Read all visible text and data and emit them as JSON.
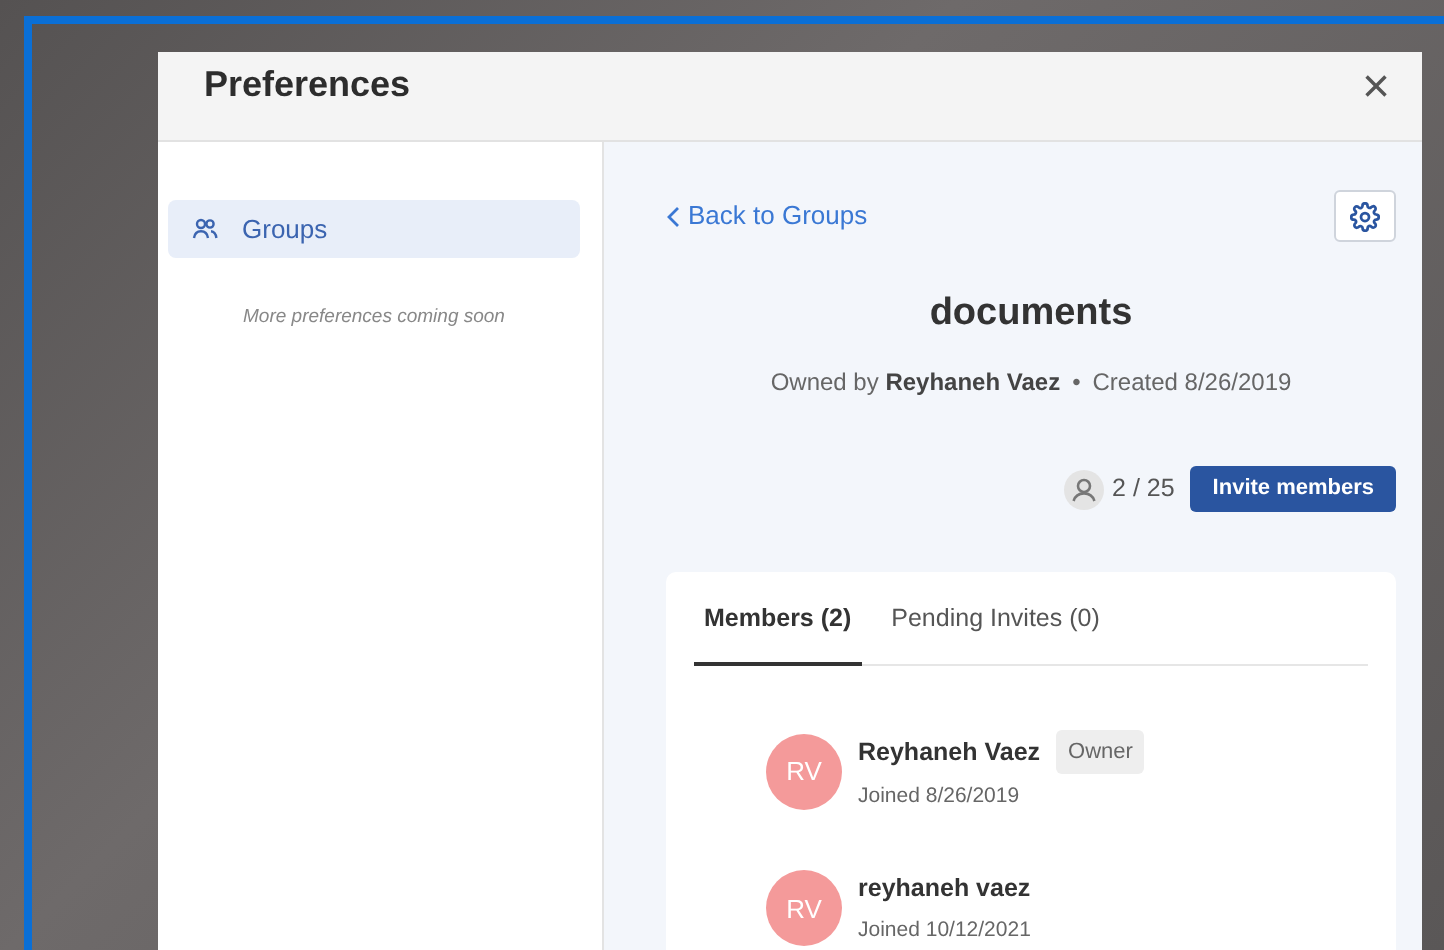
{
  "dialog": {
    "title": "Preferences",
    "close": "×"
  },
  "sidebar": {
    "items": [
      {
        "label": "Groups",
        "selected": true
      }
    ],
    "note": "More preferences coming soon"
  },
  "group": {
    "back_link": "Back to Groups",
    "name": "documents",
    "owner_prefix": "Owned by",
    "owner": "Reyhaneh Vaez",
    "separator": "•",
    "created": "Created 8/26/2019",
    "member_count": "2 / 25",
    "invite_button": "Invite members"
  },
  "tabs": [
    {
      "label": "Members (2)",
      "selected": true
    },
    {
      "label": "Pending Invites (0)",
      "selected": false
    }
  ],
  "members": [
    {
      "initials": "RV",
      "name": "Reyhaneh Vaez",
      "badge": "Owner",
      "joined": "Joined 8/26/2019"
    },
    {
      "initials": "RV",
      "name": "reyhaneh vaez",
      "joined": "Joined 10/12/2021"
    }
  ]
}
